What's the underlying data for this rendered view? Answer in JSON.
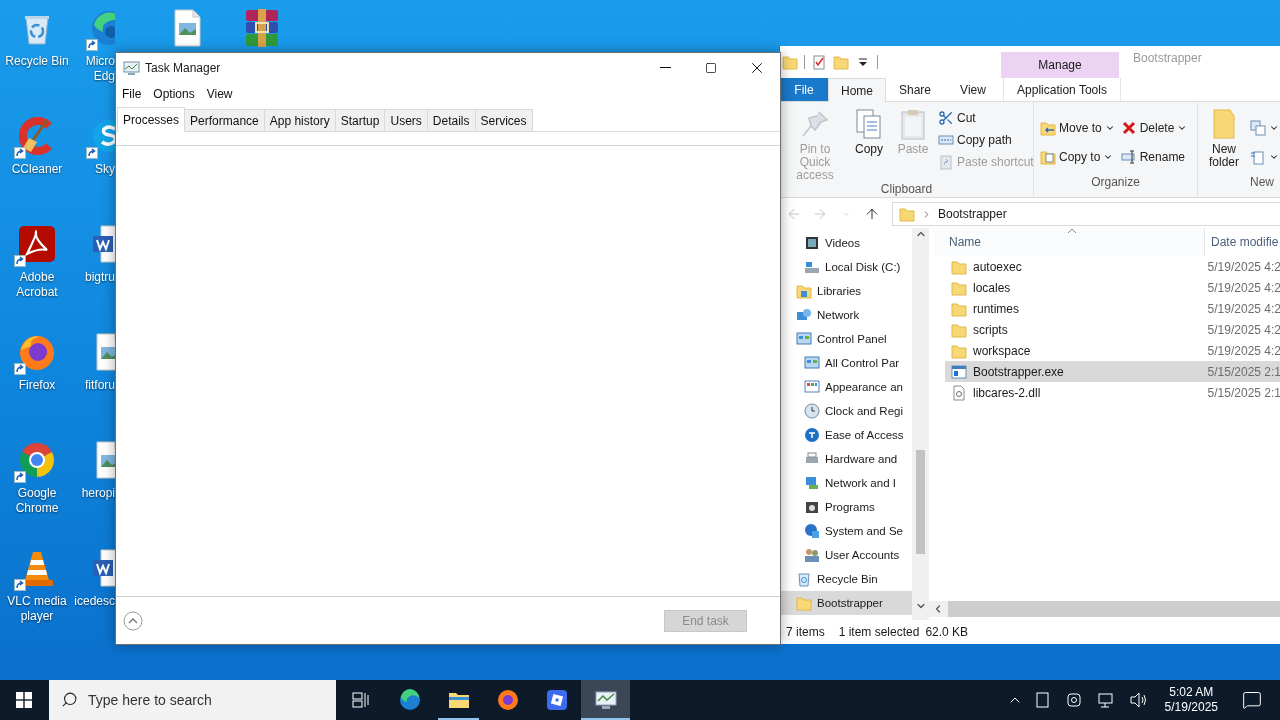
{
  "desktop": {
    "columns": [
      {
        "icons": [
          {
            "label_lines": [
              "Recycle Bin"
            ],
            "shortcut": false
          },
          {
            "label_lines": [
              "CCleaner"
            ],
            "shortcut": true
          },
          {
            "label_lines": [
              "Adobe",
              "Acrobat"
            ],
            "shortcut": true
          },
          {
            "label_lines": [
              "Firefox"
            ],
            "shortcut": true
          },
          {
            "label_lines": [
              "Google",
              "Chrome"
            ],
            "shortcut": true
          },
          {
            "label_lines": [
              "VLC media",
              "player"
            ],
            "shortcut": true
          }
        ]
      },
      {
        "icons": [
          {
            "label_lines": [
              "Micro",
              "Edg"
            ],
            "shortcut": true
          },
          {
            "label_lines": [
              "Sky"
            ],
            "shortcut": true
          },
          {
            "label_lines": [
              "bigtru"
            ],
            "shortcut": false
          },
          {
            "label_lines": [
              "fitforu"
            ],
            "shortcut": false
          },
          {
            "label_lines": [
              "heropi"
            ],
            "shortcut": false
          },
          {
            "label_lines": [
              "icedesc"
            ],
            "shortcut": false
          }
        ]
      },
      {
        "icons": [
          {
            "shortcut": false
          }
        ]
      },
      {
        "icons": [
          {
            "shortcut": false
          }
        ]
      }
    ]
  },
  "task_manager": {
    "title": "Task Manager",
    "menu": [
      "File",
      "Options",
      "View"
    ],
    "tabs": [
      {
        "label": "Processes",
        "selected": true
      },
      {
        "label": "Performance",
        "selected": false
      },
      {
        "label": "App history",
        "selected": false
      },
      {
        "label": "Startup",
        "selected": false
      },
      {
        "label": "Users",
        "selected": false
      },
      {
        "label": "Details",
        "selected": false
      },
      {
        "label": "Services",
        "selected": false
      }
    ],
    "end_task": {
      "label": "End task",
      "disabled": true
    }
  },
  "explorer": {
    "title": "Bootstrapper",
    "context_label": "Manage",
    "tabs": [
      {
        "label": "File",
        "kind": "menu",
        "selected": false
      },
      {
        "label": "Home",
        "kind": "tab",
        "selected": true
      },
      {
        "label": "Share",
        "kind": "tab",
        "selected": false
      },
      {
        "label": "View",
        "kind": "tab",
        "selected": false
      },
      {
        "label": "Application Tools",
        "kind": "context",
        "selected": false
      }
    ],
    "ribbon": [
      {
        "label": "Clipboard",
        "columns": [
          [
            {
              "label": "Pin to Quick access",
              "kind": "large",
              "disabled": true,
              "dropdown": false
            }
          ],
          [
            {
              "label": "Copy",
              "kind": "large",
              "disabled": false,
              "dropdown": false
            }
          ],
          [
            {
              "label": "Paste",
              "kind": "large",
              "disabled": true,
              "dropdown": false
            }
          ],
          [
            {
              "label": "Cut",
              "kind": "small",
              "disabled": false,
              "dropdown": false
            },
            {
              "label": "Copy path",
              "kind": "small",
              "disabled": false,
              "dropdown": false
            },
            {
              "label": "Paste shortcut",
              "kind": "small",
              "disabled": true,
              "dropdown": false
            }
          ]
        ]
      },
      {
        "label": "Organize",
        "columns": [
          [
            {
              "label": "Move to",
              "kind": "small",
              "disabled": false,
              "dropdown": true
            },
            {
              "label": "Copy to",
              "kind": "small",
              "disabled": false,
              "dropdown": true
            }
          ],
          [
            {
              "label": "Delete",
              "kind": "small",
              "disabled": false,
              "dropdown": true
            },
            {
              "label": "Rename",
              "kind": "small",
              "disabled": false,
              "dropdown": false
            }
          ]
        ]
      },
      {
        "label": "New",
        "columns": [
          [
            {
              "label": "New folder",
              "kind": "large",
              "disabled": false,
              "dropdown": false
            }
          ],
          [
            {
              "kind": "small",
              "disabled": false,
              "dropdown": true
            },
            {
              "kind": "small",
              "disabled": false,
              "dropdown": true
            }
          ]
        ]
      }
    ],
    "address": {
      "buttons": [
        {
          "disabled": true
        },
        {
          "disabled": true
        },
        {
          "disabled": true
        },
        {
          "disabled": false
        }
      ],
      "path": [
        "Bootstrapper"
      ]
    },
    "nav": [
      {
        "children": [
          {
            "label": "Videos",
            "selected": false
          },
          {
            "label": "Local Disk (C:)",
            "selected": false
          }
        ]
      },
      {
        "label": "Libraries",
        "selected": false
      },
      {
        "label": "Network",
        "selected": false
      },
      {
        "label": "Control Panel",
        "selected": false,
        "children": [
          {
            "label": "All Control Par",
            "selected": false
          },
          {
            "label": "Appearance an",
            "selected": false
          },
          {
            "label": "Clock and Regi",
            "selected": false
          },
          {
            "label": "Ease of Access",
            "selected": false
          },
          {
            "label": "Hardware and",
            "selected": false
          },
          {
            "label": "Network and I",
            "selected": false
          },
          {
            "label": "Programs",
            "selected": false
          },
          {
            "label": "System and Se",
            "selected": false
          },
          {
            "label": "User Accounts",
            "selected": false
          }
        ]
      },
      {
        "label": "Recycle Bin",
        "selected": false
      },
      {
        "label": "Bootstrapper",
        "selected": true
      }
    ],
    "columns": [
      {
        "label": "Name",
        "sorted": true
      },
      {
        "label": "Date modifie"
      }
    ],
    "files": [
      {
        "name": "autoexec",
        "date": "5/19/2025 4:2",
        "kind": "folder",
        "selected": false
      },
      {
        "name": "locales",
        "date": "5/19/2025 4:2",
        "kind": "folder",
        "selected": false
      },
      {
        "name": "runtimes",
        "date": "5/19/2025 4:2",
        "kind": "folder",
        "selected": false
      },
      {
        "name": "scripts",
        "date": "5/19/2025 4:2",
        "kind": "folder",
        "selected": false
      },
      {
        "name": "workspace",
        "date": "5/19/2025 4:2",
        "kind": "folder",
        "selected": false
      },
      {
        "name": "Bootstrapper.exe",
        "date": "5/15/2025 2:1",
        "kind": "exe",
        "selected": true
      },
      {
        "name": "libcares-2.dll",
        "date": "5/15/2025 2:1",
        "kind": "dll",
        "selected": false
      }
    ],
    "status": [
      "7 items",
      "1 item selected",
      "62.0 KB"
    ]
  },
  "taskbar": {
    "search_placeholder": "Type here to search",
    "apps": [
      {
        "active": false,
        "open": false
      },
      {
        "active": false,
        "open": true
      },
      {
        "active": false,
        "open": false
      },
      {
        "active": false,
        "open": false
      },
      {
        "active": true,
        "open": true
      }
    ],
    "time": "5:02 AM",
    "date": "5/19/2025"
  }
}
